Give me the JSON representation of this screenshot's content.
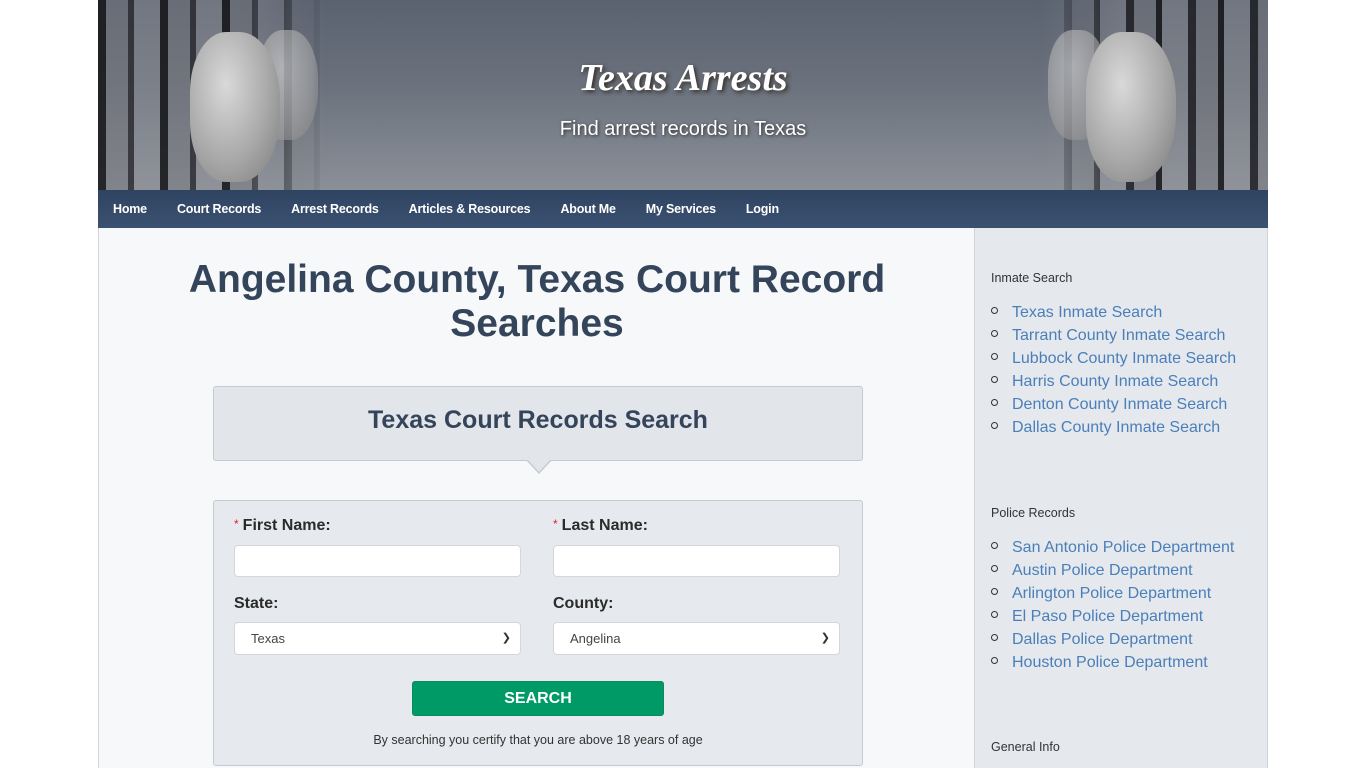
{
  "header": {
    "site_title": "Texas Arrests",
    "tagline": "Find arrest records in Texas"
  },
  "nav": {
    "items": [
      {
        "label": "Home"
      },
      {
        "label": "Court Records"
      },
      {
        "label": "Arrest Records"
      },
      {
        "label": "Articles & Resources"
      },
      {
        "label": "About Me"
      },
      {
        "label": "My Services"
      },
      {
        "label": "Login"
      }
    ]
  },
  "main": {
    "page_title": "Angelina County, Texas Court Record Searches",
    "search_box_title": "Texas Court Records Search",
    "form": {
      "required_marker": "*",
      "first_name_label": "First Name:",
      "first_name_value": "",
      "last_name_label": "Last Name:",
      "last_name_value": "",
      "state_label": "State:",
      "state_value": "Texas",
      "county_label": "County:",
      "county_value": "Angelina",
      "search_button": "SEARCH",
      "age_note": "By searching you certify that you are above 18 years of age"
    }
  },
  "sidebar": {
    "sections": [
      {
        "heading": "Inmate Search",
        "links": [
          "Texas Inmate Search",
          "Tarrant County Inmate Search",
          "Lubbock County Inmate Search",
          "Harris County Inmate Search",
          "Denton County Inmate Search",
          "Dallas County Inmate Search"
        ]
      },
      {
        "heading": "Police Records",
        "links": [
          "San Antonio Police Department",
          "Austin Police Department",
          "Arlington Police Department",
          "El Paso Police Department",
          "Dallas Police Department",
          "Houston Police Department"
        ]
      },
      {
        "heading": "General Info",
        "links": []
      }
    ]
  },
  "colors": {
    "nav_bg": "#34496a",
    "title_text": "#34445a",
    "link": "#4a7fba",
    "search_button": "#009a66",
    "required": "#d9232d"
  }
}
